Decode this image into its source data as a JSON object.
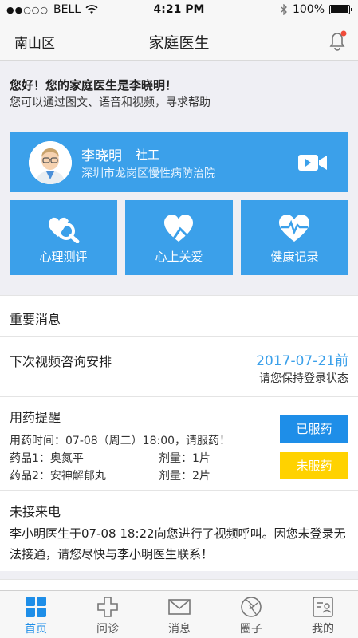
{
  "status_bar": {
    "carrier": "BELL",
    "time": "4:21 PM",
    "battery": "100%"
  },
  "nav": {
    "location": "南山区",
    "title": "家庭医生"
  },
  "greeting": {
    "line1": "您好！您的家庭医生是李晓明！",
    "line2": "您可以通过图文、语音和视频，寻求帮助"
  },
  "doctor": {
    "name": "李晓明",
    "role": "社工",
    "hospital": "深圳市龙岗区慢性病防治院"
  },
  "tiles": [
    {
      "label": "心理测评",
      "icon": "psych-test-icon"
    },
    {
      "label": "心上关爱",
      "icon": "heart-care-icon"
    },
    {
      "label": "健康记录",
      "icon": "health-record-icon"
    }
  ],
  "news": {
    "header": "重要消息",
    "video_consult": {
      "title": "下次视频咨询安排",
      "date": "2017-07-21前",
      "note": "请您保持登录状态"
    },
    "medication": {
      "title": "用药提醒",
      "time_line": "用药时间：07-08（周二）18:00，请服药！",
      "drug1": "药品1：奥氮平",
      "dose1": "剂量：1片",
      "drug2": "药品2：安神解郁丸",
      "dose2": "剂量：2片",
      "taken_label": "已服药",
      "untaken_label": "未服药"
    },
    "missed_call": {
      "title": "未接来电",
      "message": "李小明医生于07-08 18:22向您进行了视频呼叫。因您未登录无法接通，请您尽快与李小明医生联系！"
    }
  },
  "tabbar": [
    {
      "label": "首页",
      "icon": "home-grid-icon",
      "active": true
    },
    {
      "label": "问诊",
      "icon": "cross-icon",
      "active": false
    },
    {
      "label": "消息",
      "icon": "envelope-icon",
      "active": false
    },
    {
      "label": "圈子",
      "icon": "aperture-icon",
      "active": false
    },
    {
      "label": "我的",
      "icon": "profile-card-icon",
      "active": false
    }
  ],
  "colors": {
    "primary": "#3ba0ea",
    "accent_blue": "#1e8ee8",
    "warning_yellow": "#ffd200",
    "badge_red": "#f04b3a"
  }
}
